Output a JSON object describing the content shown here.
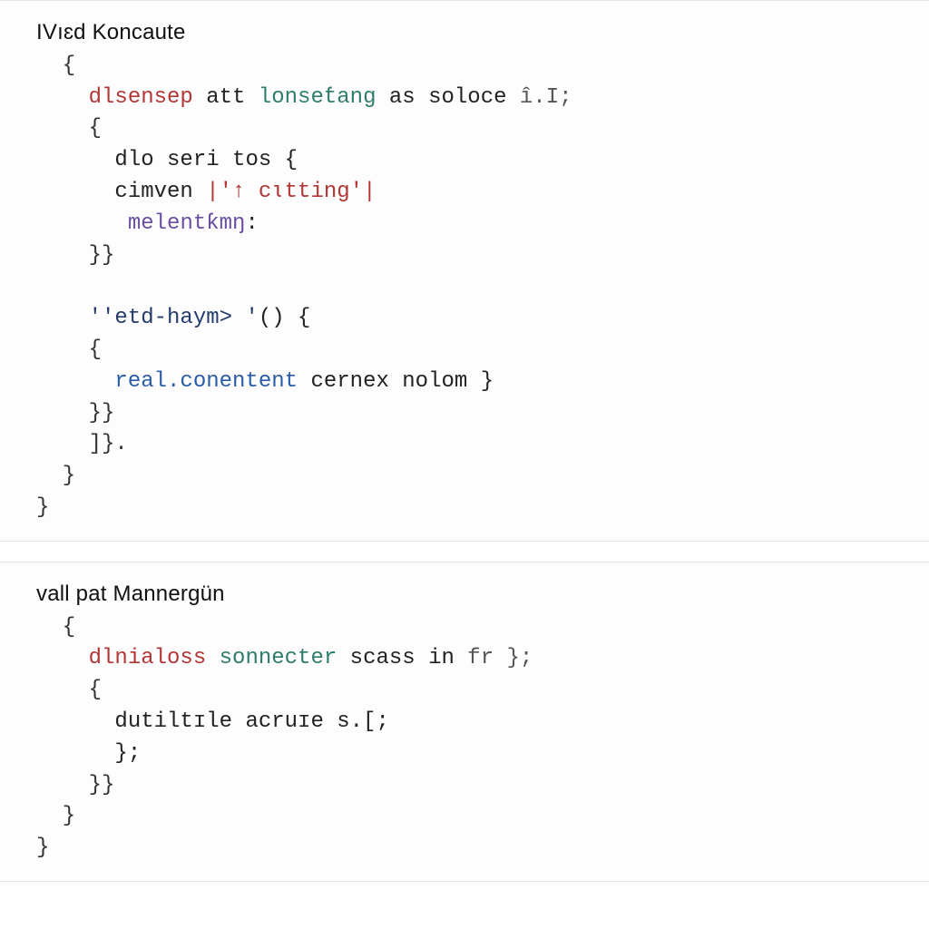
{
  "panels": [
    {
      "title": "IVıɛd Koncaute",
      "l0": "  {",
      "l1a": "    ",
      "l1b": "dlsensep",
      "l1c": " att ",
      "l1d": "lonseƭang",
      "l1e": " as soloce ",
      "l1f": "î.I;",
      "l2": "    {",
      "l3": "      dlo seri tos {",
      "l4a": "      cimven ",
      "l4b": "|'↑ cɩtting'|",
      "l5a": "       ",
      "l5b": "melentƙmŋ",
      "l5c": ":",
      "l6": "    }}",
      "blank1": "",
      "l7a": "    ",
      "l7b": "''etd-haym> '",
      "l7c": "() {",
      "l8": "    {",
      "l9a": "      ",
      "l9b": "real.conentent",
      "l9c": " cernex nolom }",
      "l10": "    }}",
      "l11": "    ]}.",
      "l12": "  }",
      "l13": "}"
    },
    {
      "title": "vall pat Mannergün",
      "l0": "  {",
      "l1a": "    ",
      "l1b": "dlnialoss",
      "l1c": " ",
      "l1d": "sonnecter",
      "l1e": " scass in ",
      "l1f": "fr };",
      "l2": "    {",
      "l3": "      dutiltɪle acruɪe s.[;",
      "l4": "      };",
      "l5": "    }}",
      "l6": "  }",
      "l7": "}"
    }
  ]
}
